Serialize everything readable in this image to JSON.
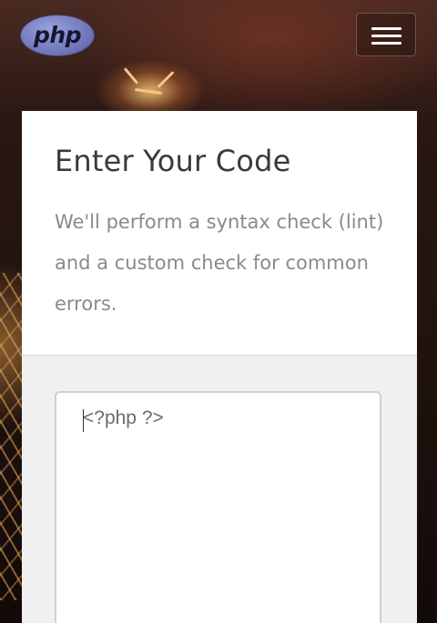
{
  "navbar": {
    "logo_text": "php",
    "logo_icon": "php-logo",
    "menu_icon": "hamburger-menu-icon"
  },
  "card": {
    "title": "Enter Your Code",
    "description": "We'll perform a syntax check (lint) and a custom check for common errors."
  },
  "editor": {
    "value": "<?php ?>"
  },
  "colors": {
    "logo_fill": "#7a81c4",
    "card_background": "#ffffff",
    "body_background": "#f0f0f0",
    "title_text": "#3a3a3a",
    "description_text": "#8a8a8a"
  }
}
